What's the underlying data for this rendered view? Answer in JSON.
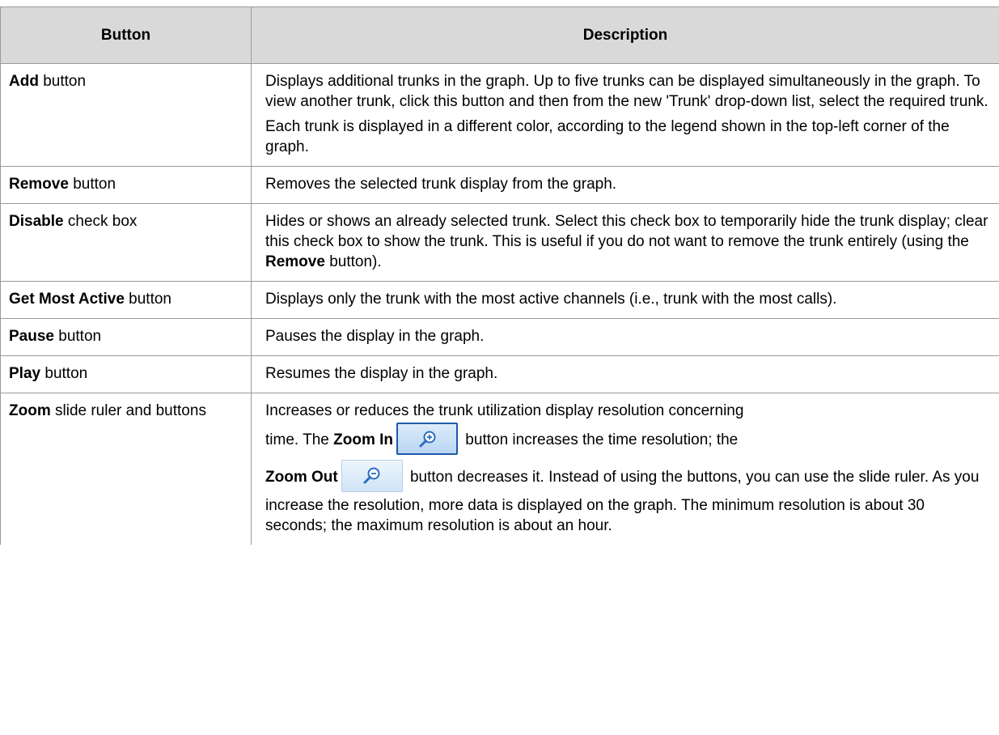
{
  "table": {
    "headers": [
      "Button",
      "Description"
    ],
    "rows": [
      {
        "name_bold": "Add",
        "name_rest": " button",
        "desc": [
          "Displays additional trunks in the graph. Up to five trunks can be displayed simultaneously in the graph. To view another trunk, click this button and then from the new 'Trunk' drop-down list, select the required trunk.",
          "Each trunk is displayed in a different color, according to the legend shown in the top-left corner of the graph."
        ]
      },
      {
        "name_bold": "Remove",
        "name_rest": " button",
        "desc": [
          "Removes the selected trunk display from the graph."
        ]
      },
      {
        "name_bold": "Disable",
        "name_rest": " check box",
        "desc_a": "Hides or shows an already selected trunk. Select this check box to temporarily hide the trunk display; clear this check box to show the trunk. This is useful if you do not want to remove the trunk entirely (using the ",
        "desc_b": "Remove",
        "desc_c": " button)."
      },
      {
        "name_bold": "Get Most Active",
        "name_rest": " button",
        "desc": [
          "Displays only the trunk with the most active channels (i.e., trunk with the most calls)."
        ]
      },
      {
        "name_bold": "Pause",
        "name_rest": " button",
        "desc": [
          "Pauses the display in the graph."
        ]
      },
      {
        "name_bold": "Play",
        "name_rest": " button",
        "desc": [
          "Resumes the display in the graph."
        ]
      },
      {
        "name_bold": "Zoom",
        "name_rest": " slide ruler and buttons",
        "t1": "Increases or reduces the trunk utilization display resolution concerning",
        "t2": "time. The ",
        "t3": "Zoom In",
        "t4": " button increases the time resolution; the",
        "t5": "Zoom Out",
        "t6": " button decreases it. Instead of using the buttons, you can use the slide ruler. As you increase the resolution, more data is displayed on the graph. The minimum resolution is about 30 seconds; the maximum resolution is about an hour.",
        "icons": [
          "zoom-in-icon",
          "zoom-out-icon"
        ]
      }
    ]
  }
}
